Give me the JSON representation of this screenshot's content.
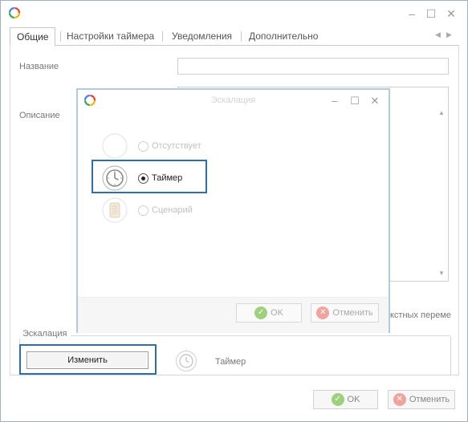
{
  "window": {
    "title": "",
    "controls": [
      "minimize-icon",
      "maximize-icon",
      "close-icon"
    ]
  },
  "tabs": [
    {
      "label": "Общие",
      "active": true
    },
    {
      "label": "Настройки таймера",
      "active": false
    },
    {
      "label": "Уведомления",
      "active": false
    },
    {
      "label": "Дополнительно",
      "active": false
    }
  ],
  "form": {
    "name_label": "Название",
    "name_value": "",
    "description_label": "Описание",
    "description_value": "",
    "peek_text": "кстных переме"
  },
  "escalation": {
    "legend": "Эскалация",
    "change_button": "Изменить",
    "current_value": "Таймер"
  },
  "footer": {
    "ok_label": "OK",
    "cancel_label": "Отменить"
  },
  "modal": {
    "title": "Эскалация",
    "options": [
      {
        "label": "Отсутствует",
        "icon": "empty-icon",
        "checked": false
      },
      {
        "label": "Таймер",
        "icon": "clock-icon",
        "checked": true
      },
      {
        "label": "Сценарий",
        "icon": "script-scroll-icon",
        "checked": false
      }
    ],
    "ok_label": "OK",
    "cancel_label": "Отменить"
  },
  "colors": {
    "highlight": "#2f6fa8",
    "ok_green": "#9fd07e",
    "cancel_red": "#f0a39e",
    "window_border": "#9fb1c6"
  }
}
